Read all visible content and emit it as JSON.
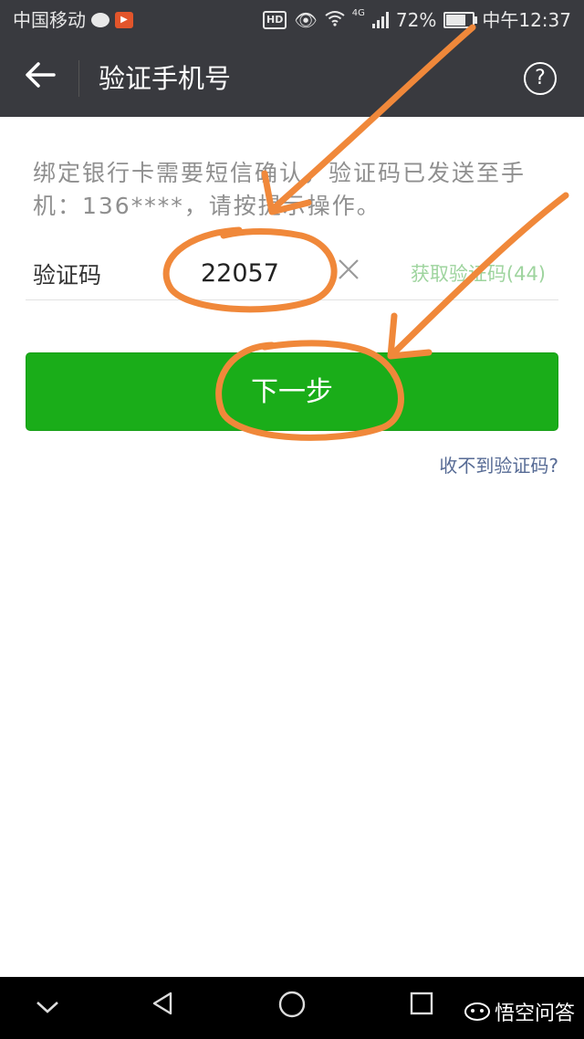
{
  "status_bar": {
    "carrier": "中国移动",
    "hd": "HD",
    "network": "4G",
    "battery_percent": "72%",
    "battery_level": 0.72,
    "time": "中午12:37"
  },
  "nav": {
    "title": "验证手机号"
  },
  "content": {
    "hint": "绑定银行卡需要短信确认，验证码已发送至手机：136****，请按提示操作。",
    "code_label": "验证码",
    "code_value": "22057",
    "resend_label": "获取验证码(44)",
    "next_label": "下一步",
    "no_code_label": "收不到验证码?"
  },
  "watermark": {
    "text": "悟空问答"
  },
  "colors": {
    "header_bg": "#393a3f",
    "primary_button": "#1aad19",
    "link": "#576b95",
    "resend_disabled": "#9ed49e",
    "annotation": "#f0883a"
  },
  "icons": {
    "back": "arrow-left-icon",
    "help": "question-circle-icon",
    "clear": "close-icon",
    "nav_back": "triangle-back-icon",
    "nav_home": "circle-home-icon",
    "nav_recent": "square-recent-icon",
    "nav_collapse": "chevron-down-icon"
  }
}
